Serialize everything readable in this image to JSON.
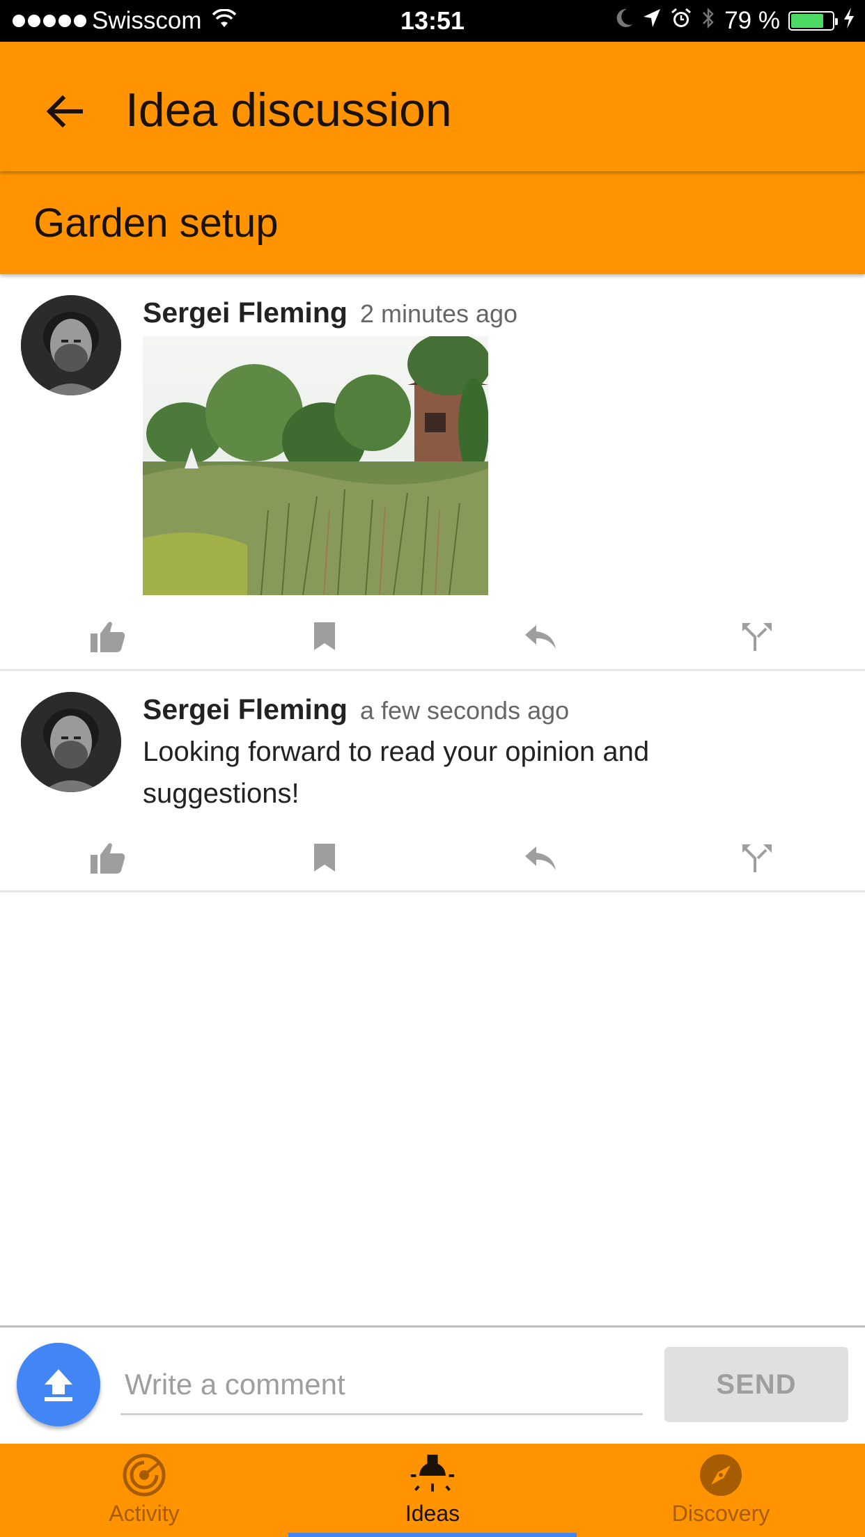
{
  "status_bar": {
    "carrier": "Swisscom",
    "time": "13:51",
    "battery_text": "79 %",
    "battery_level": 0.79,
    "icons": [
      "signal-dots-icon",
      "wifi-icon",
      "moon-icon",
      "location-arrow-icon",
      "alarm-icon",
      "bluetooth-icon",
      "battery-icon",
      "charging-bolt-icon"
    ]
  },
  "header": {
    "title": "Idea discussion",
    "back_icon": "arrow-left-icon"
  },
  "idea": {
    "title": "Garden setup"
  },
  "posts": [
    {
      "author": "Sergei Fleming",
      "time": "2 minutes ago",
      "has_photo": true,
      "text": ""
    },
    {
      "author": "Sergei Fleming",
      "time": "a few seconds ago",
      "has_photo": false,
      "text": "Looking forward to read your opinion and suggestions!"
    }
  ],
  "post_actions": [
    "thumbs-up-icon",
    "bookmark-icon",
    "reply-icon",
    "fork-icon"
  ],
  "composer": {
    "placeholder": "Write a comment",
    "value": "",
    "send_label": "SEND"
  },
  "bottom_nav": {
    "items": [
      {
        "label": "Activity",
        "icon": "radar-icon",
        "selected": false
      },
      {
        "label": "Ideas",
        "icon": "lightbulb-icon",
        "selected": true
      },
      {
        "label": "Discovery",
        "icon": "compass-icon",
        "selected": false
      }
    ]
  },
  "colors": {
    "primary": "#ff9400",
    "accent": "#4285f4",
    "action_icon": "#9e9e9e"
  }
}
